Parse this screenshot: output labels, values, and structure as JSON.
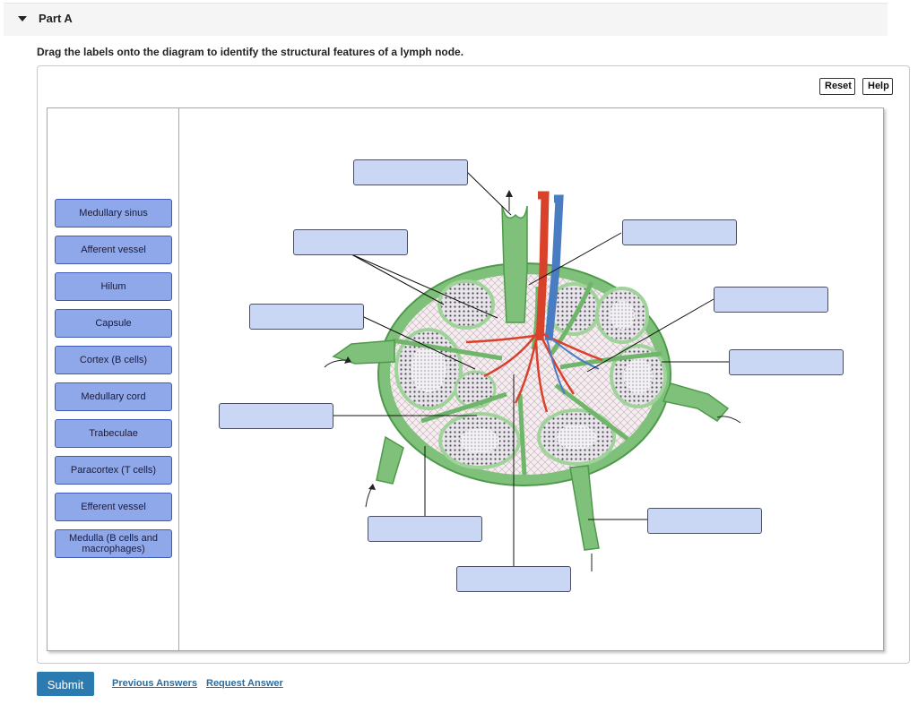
{
  "part": {
    "title": "Part A"
  },
  "instruction": "Drag the labels onto the diagram to identify the structural features of a lymph node.",
  "toolbar": {
    "reset_label": "Reset",
    "help_label": "Help"
  },
  "labels": [
    "Medullary sinus",
    "Afferent vessel",
    "Hilum",
    "Capsule",
    "Cortex (B cells)",
    "Medullary cord",
    "Trabeculae",
    "Paracortex (T cells)",
    "Efferent vessel",
    "Medulla (B cells and macrophages)"
  ],
  "footer": {
    "submit_label": "Submit",
    "previous_answers_label": "Previous Answers",
    "request_answer_label": "Request Answer"
  },
  "colors": {
    "accent": "#2b7ab0",
    "label_fill": "#8fa8ea",
    "target_fill": "#c9d6f4",
    "capsule_green": "#6fb56a",
    "artery_red": "#d9412b",
    "vein_blue": "#4a7cc2"
  }
}
